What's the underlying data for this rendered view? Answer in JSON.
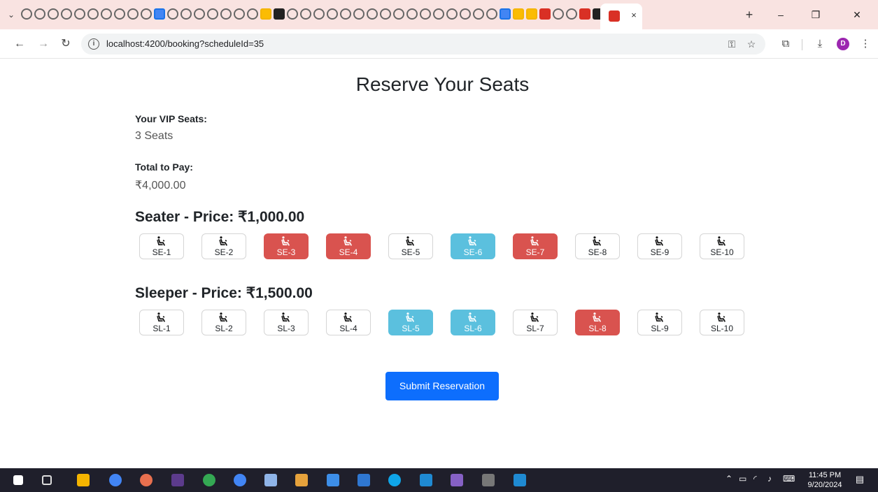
{
  "browser": {
    "url": "localhost:4200/booking?scheduleId=35",
    "tab_close": "×",
    "new_tab": "+",
    "minimize": "–",
    "restore": "❐",
    "close": "✕",
    "profile_initial": "D"
  },
  "page": {
    "title": "Reserve Your Seats",
    "vip_label": "Your VIP Seats:",
    "vip_value": "3 Seats",
    "total_label": "Total to Pay:",
    "total_value": "₹4,000.00"
  },
  "seater": {
    "title": "Seater - Price: ₹1,000.00",
    "seats": [
      {
        "label": "SE-1",
        "status": "available"
      },
      {
        "label": "SE-2",
        "status": "available"
      },
      {
        "label": "SE-3",
        "status": "booked"
      },
      {
        "label": "SE-4",
        "status": "booked"
      },
      {
        "label": "SE-5",
        "status": "available"
      },
      {
        "label": "SE-6",
        "status": "selected"
      },
      {
        "label": "SE-7",
        "status": "booked"
      },
      {
        "label": "SE-8",
        "status": "available"
      },
      {
        "label": "SE-9",
        "status": "available"
      },
      {
        "label": "SE-10",
        "status": "available"
      }
    ]
  },
  "sleeper": {
    "title": "Sleeper - Price: ₹1,500.00",
    "seats": [
      {
        "label": "SL-1",
        "status": "available"
      },
      {
        "label": "SL-2",
        "status": "available"
      },
      {
        "label": "SL-3",
        "status": "available"
      },
      {
        "label": "SL-4",
        "status": "available"
      },
      {
        "label": "SL-5",
        "status": "selected"
      },
      {
        "label": "SL-6",
        "status": "selected"
      },
      {
        "label": "SL-7",
        "status": "available"
      },
      {
        "label": "SL-8",
        "status": "booked"
      },
      {
        "label": "SL-9",
        "status": "available"
      },
      {
        "label": "SL-10",
        "status": "available"
      }
    ]
  },
  "actions": {
    "submit_label": "Submit Reservation"
  },
  "colors": {
    "booked": "#d9534f",
    "selected": "#5bc0de",
    "primary": "#0d6efd"
  },
  "taskbar": {
    "time": "11:45 PM",
    "date": "9/20/2024"
  }
}
